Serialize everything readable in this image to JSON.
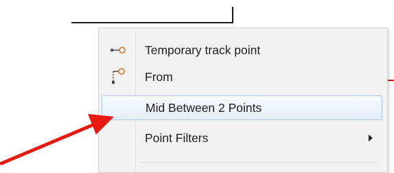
{
  "context_menu": {
    "items": [
      {
        "label": "Temporary track point",
        "icon": "temporary-track-point-icon",
        "state": "normal",
        "has_submenu": false
      },
      {
        "label": "From",
        "icon": "from-icon",
        "state": "normal",
        "has_submenu": false
      },
      {
        "label": "Mid Between 2 Points",
        "icon": "",
        "state": "hovered",
        "has_submenu": false
      },
      {
        "label": "Point Filters",
        "icon": "",
        "state": "normal",
        "has_submenu": true
      }
    ]
  },
  "colors": {
    "annotation_arrow": "#e81a10",
    "hover_border": "#a9c6e8",
    "icon_orange": "#d9823a",
    "menu_background": "#f2f2f2"
  }
}
